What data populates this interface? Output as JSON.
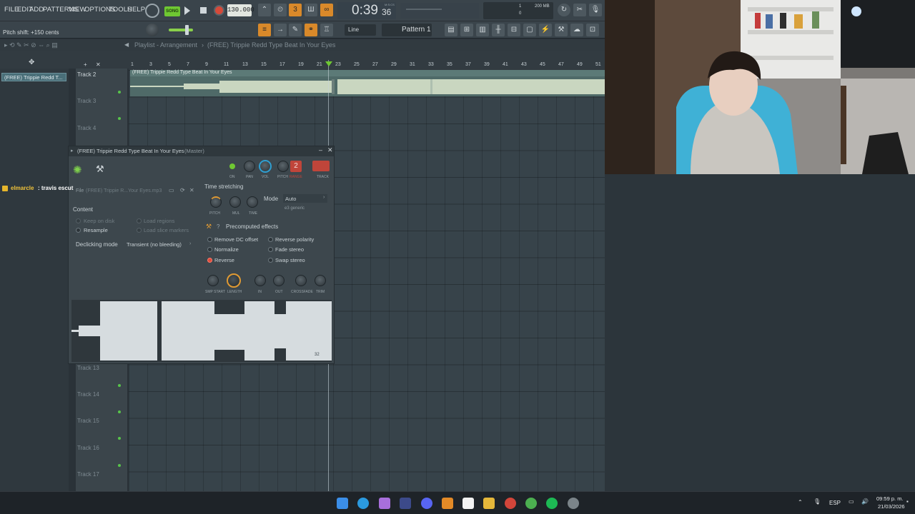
{
  "menu": {
    "items": [
      "FILE",
      "EDIT",
      "ADD",
      "PATTERNS",
      "VIEW",
      "OPTIONS",
      "TOOLS",
      "HELP"
    ]
  },
  "transport": {
    "song_label": "SONG",
    "tempo": "130.000",
    "time_main": "0:39",
    "time_sub": "36",
    "time_unit": "M:S:CS",
    "mem": "200 MB",
    "cpu_top": "1",
    "cpu_bottom": "0"
  },
  "hint_bar": {
    "text": "Pitch shift: +150 cents"
  },
  "toolbar2": {
    "snap": "Line",
    "pattern": "Pattern 1"
  },
  "playlist": {
    "title": "Playlist - Arrangement",
    "project": "(FREE) Trippie Redd Type Beat In Your Eyes",
    "picker_item": "(FREE) Trippie Redd T...",
    "clip_label": "(FREE) Trippie Redd Type Beat In Your Eyes",
    "ruler": [
      "1",
      "3",
      "5",
      "7",
      "9",
      "11",
      "13",
      "15",
      "17",
      "19",
      "21",
      "23",
      "25",
      "27",
      "29",
      "31",
      "33",
      "35",
      "37",
      "39",
      "41",
      "43",
      "45",
      "47",
      "49",
      "51"
    ],
    "tracks": [
      {
        "label": "Track 2"
      },
      {
        "label": "Track 3"
      },
      {
        "label": "Track 4"
      },
      {
        "label": "Track 13"
      },
      {
        "label": "Track 14"
      },
      {
        "label": "Track 15"
      },
      {
        "label": "Track 16"
      },
      {
        "label": "Track 17"
      }
    ]
  },
  "sampler": {
    "title": "(FREE) Trippie Redd Type Beat In Your Eyes",
    "title_suffix": "(Master)",
    "file_label": "File",
    "file_name": "(FREE) Trippie R...Your Eyes.mp3",
    "chat_user": "elmarcle",
    "chat_text": ": travis escut",
    "top_labels": [
      "ON",
      "PAN",
      "VOL",
      "PITCH",
      "RANGE",
      "TRACK"
    ],
    "track_number": "2",
    "content_label": "Content",
    "keep_on_disk": "Keep on disk",
    "resample": "Resample",
    "load_regions": "Load regions",
    "load_slice_markers": "Load slice markers",
    "declicking_label": "Declicking mode",
    "declicking_value": "Transient (no bleeding)",
    "time_stretching": "Time stretching",
    "ts_knobs": [
      "PITCH",
      "MUL",
      "TIME"
    ],
    "mode_label": "Mode",
    "mode_value": "Auto",
    "mode_sub": "e3 generic",
    "precomputed": "Precomputed effects",
    "effects_left": [
      "Remove DC offset",
      "Normalize",
      "Reverse"
    ],
    "effects_right": [
      "Reverse polarity",
      "Fade stereo",
      "Swap stereo"
    ],
    "bottom_knobs": [
      "SMP START",
      "LENGTH",
      "IN",
      "OUT",
      "CROSSFADE",
      "TRIM"
    ],
    "wave_footer": "32"
  },
  "taskbar": {
    "lang": "ESP",
    "time": "09:59 p. m.",
    "date": "21/03/2026"
  },
  "colors": {
    "accent_orange": "#d9892a",
    "fl_green": "#58c44a",
    "record_red": "#d64a3a",
    "waveform": "#c9d6c0"
  }
}
